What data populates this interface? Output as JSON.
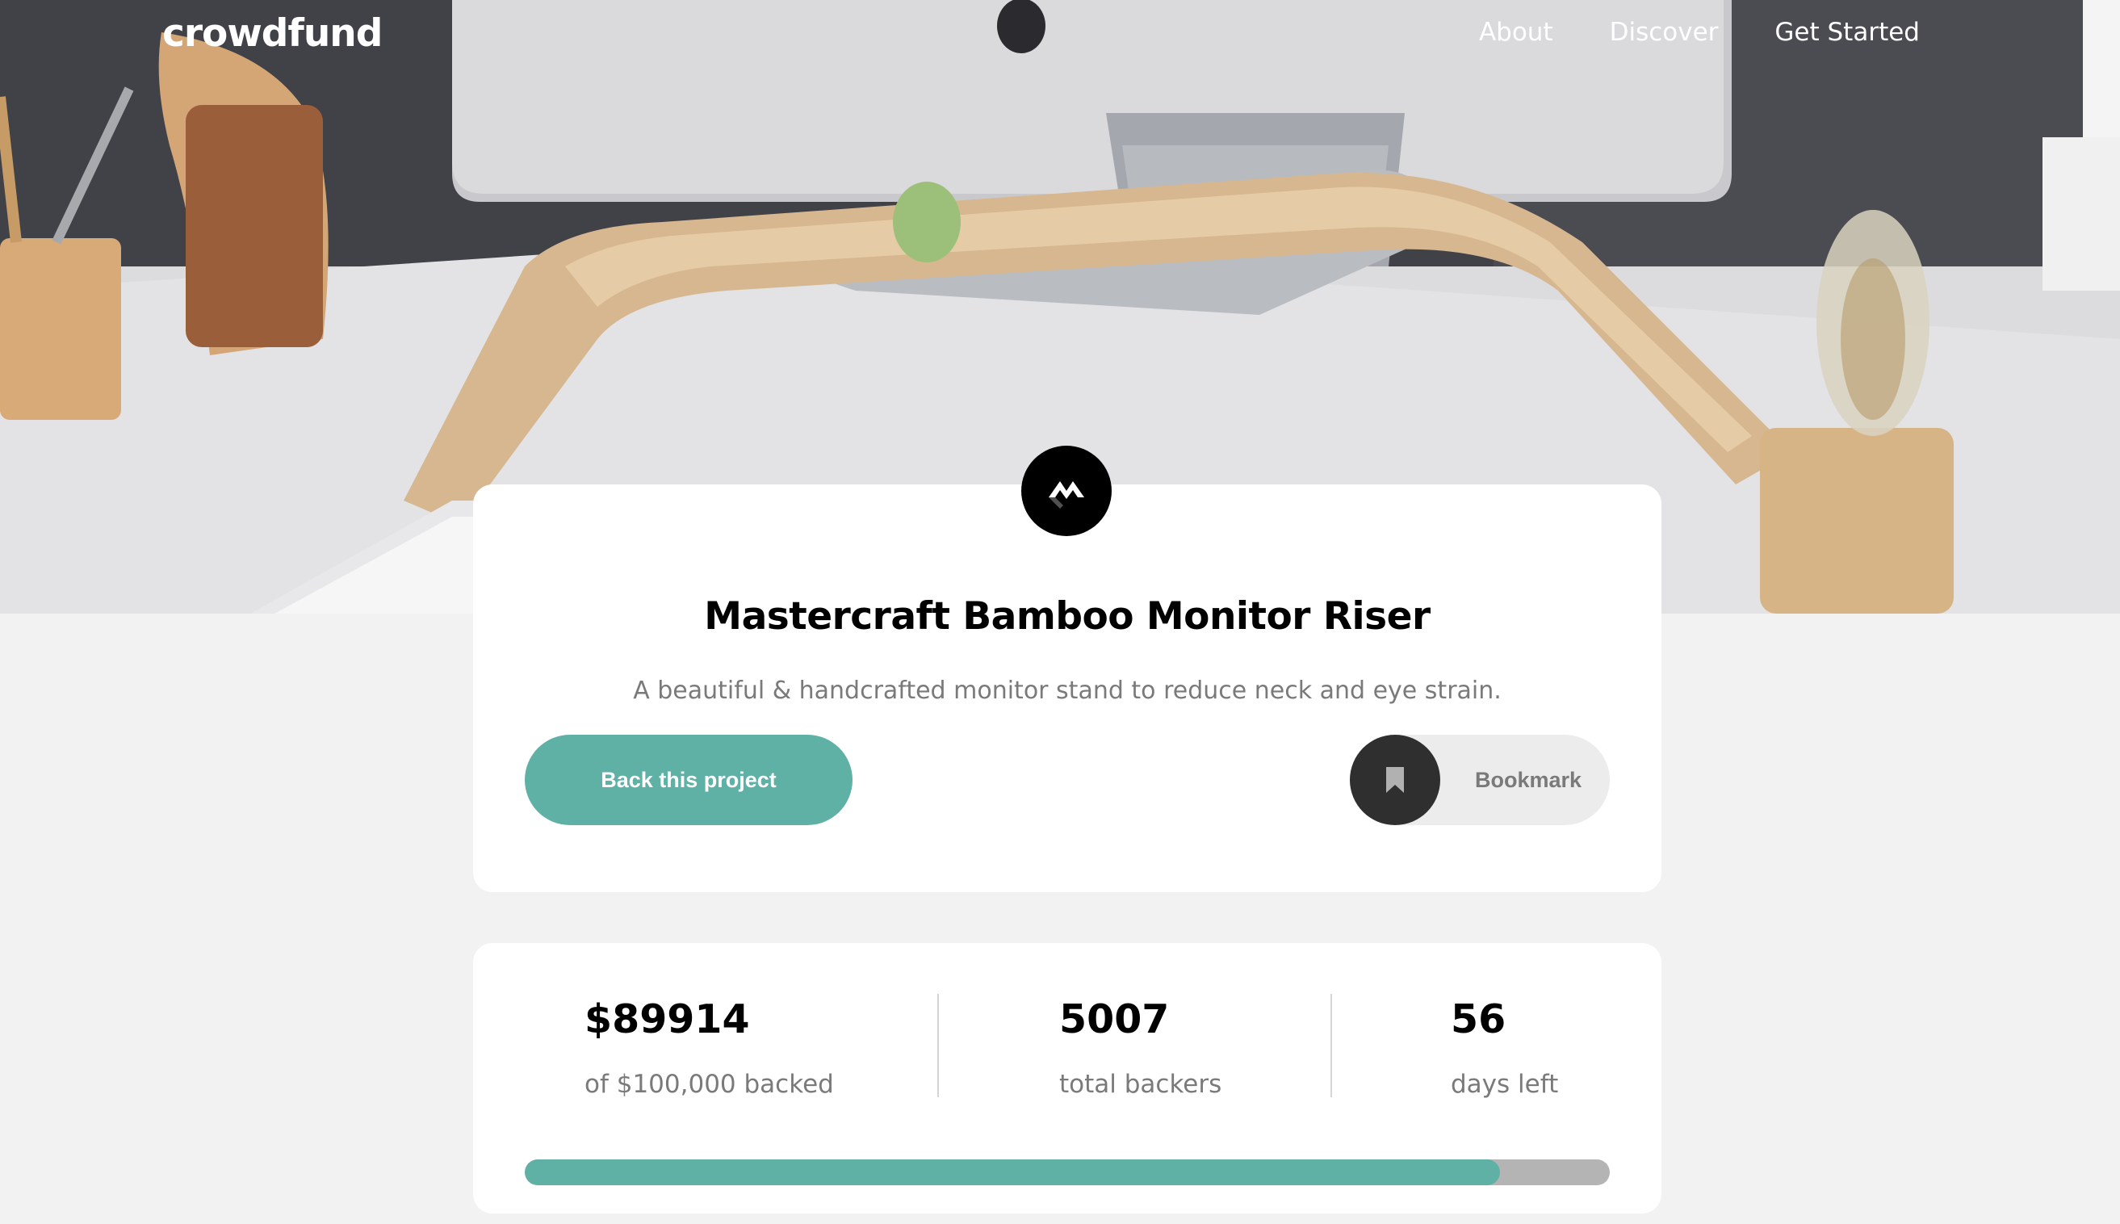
{
  "header": {
    "logo": "crowdfund",
    "nav": [
      {
        "label": "About"
      },
      {
        "label": "Discover"
      },
      {
        "label": "Get Started"
      }
    ]
  },
  "project": {
    "title": "Mastercraft Bamboo Monitor Riser",
    "description": "A beautiful & handcrafted monitor stand to reduce neck and eye strain.",
    "back_label": "Back this project",
    "bookmark_label": "Bookmark"
  },
  "stats": {
    "backed": {
      "value": "$89914",
      "label": "of $100,000 backed"
    },
    "backers": {
      "value": "5007",
      "label": "total backers"
    },
    "days": {
      "value": "56",
      "label": "days left"
    },
    "progress_fraction": 0.8991
  },
  "colors": {
    "accent": "#5fb1a6",
    "background": "#f2f2f2",
    "card": "#ffffff"
  },
  "icons": {
    "brand": "mastercraft-logo-icon",
    "bookmark": "bookmark-icon"
  }
}
